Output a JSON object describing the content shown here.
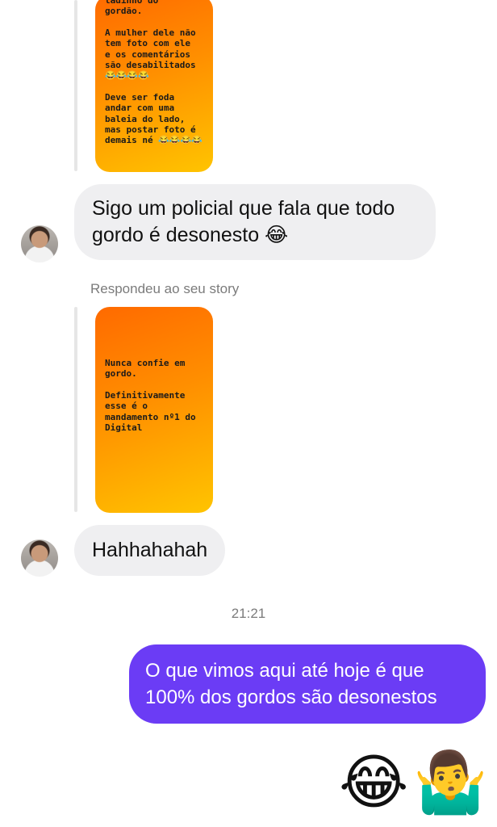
{
  "story1": {
    "lines": [
      "ladinho do\ngordão.",
      "A mulher dele não\ntem foto com ele\ne os comentários\nsão desabilitados\n😂😂😂😂",
      "Deve ser foda\nandar com uma\nbaleia do lado,\nmas postar foto é\ndemais né 😂😂😂😂"
    ]
  },
  "message1": {
    "text": "Sigo um policial que fala que todo gordo é desonesto 😂"
  },
  "reply_label": "Respondeu ao seu story",
  "story2": {
    "lines": [
      "Nunca confie em\ngordo.",
      "Definitivamente\nesse é o\nmandamento nº1 do\nDigital"
    ]
  },
  "message2": {
    "text": "Hahhahahah"
  },
  "timestamp": "21:21",
  "outgoing": {
    "text": "O que vimos aqui até hoje é que 100% dos gordos são desonestos"
  },
  "emoji_reply": {
    "laugh": "😂",
    "shrug": "🤷‍♂️"
  },
  "colors": {
    "outgoing_bubble": "#6b3cf5",
    "incoming_bubble": "#efeff1",
    "story_gradient_start": "#ff6a00",
    "story_gradient_end": "#ffc400"
  }
}
